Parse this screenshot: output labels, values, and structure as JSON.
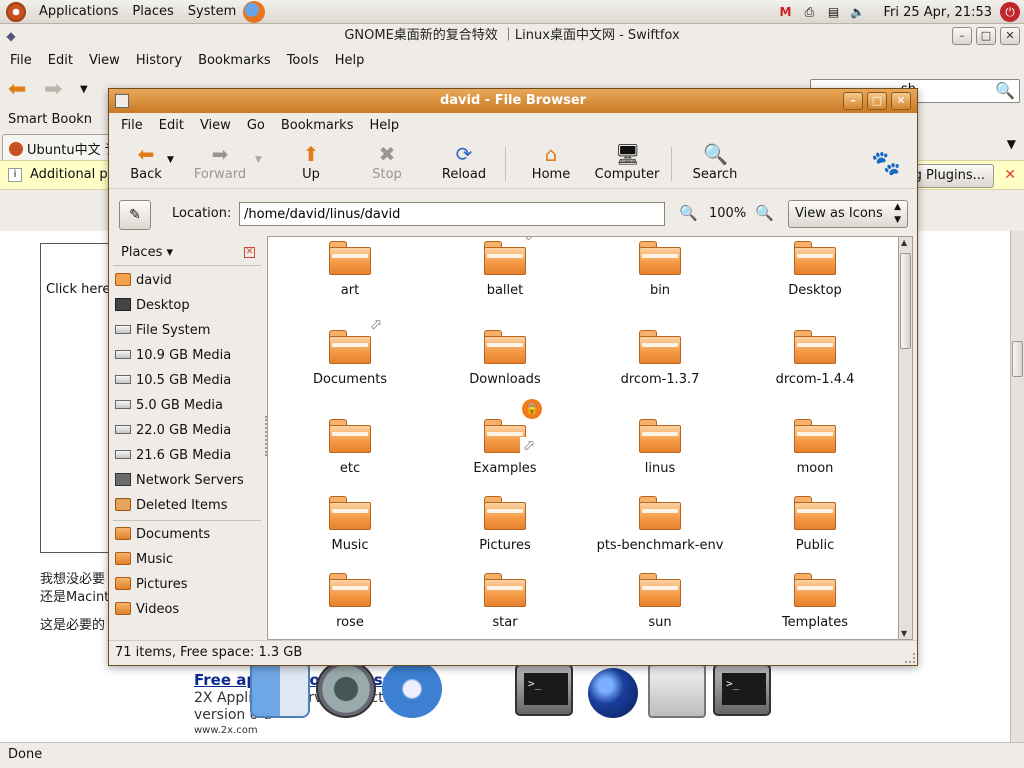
{
  "panel": {
    "menus": [
      "Applications",
      "Places",
      "System"
    ],
    "clock": "Fri 25 Apr, 21:53",
    "tray_icons": [
      "mail-icon",
      "printer-icon",
      "network-icon",
      "volume-icon"
    ]
  },
  "firefox": {
    "title": "GNOME桌面新的复合特效 ｜Linux桌面中文网 - Swiftfox",
    "menus": [
      "File",
      "Edit",
      "View",
      "History",
      "Bookmarks",
      "Tools",
      "Help"
    ],
    "search_text": "sh",
    "bookmarks_label": "Smart Bookn",
    "tab_label": "Ubuntu中文 讠",
    "notification": "Additional pl",
    "plugins_button": "g Plugins...",
    "status": "Done",
    "page": {
      "click_here": "Click here",
      "line1": "我想没必要",
      "line2": "还是Macinto",
      "line3": "这是必要的",
      "ad_title": "Free application access",
      "ad_line1": "2X Applicatio Serve      e 5      ection",
      "ad_line2": "version o         d",
      "ad_url": "www.2x.com"
    }
  },
  "file_browser": {
    "title": "david - File Browser",
    "menus": [
      "File",
      "Edit",
      "View",
      "Go",
      "Bookmarks",
      "Help"
    ],
    "toolbar": {
      "back": "Back",
      "forward": "Forward",
      "up": "Up",
      "stop": "Stop",
      "reload": "Reload",
      "home": "Home",
      "computer": "Computer",
      "search": "Search"
    },
    "location_label": "Location:",
    "location_value": "/home/david/linus/david",
    "zoom": "100%",
    "view_mode": "View as Icons",
    "places_label": "Places",
    "sidebar": [
      {
        "label": "david",
        "icon": "home-folder-icon"
      },
      {
        "label": "Desktop",
        "icon": "desktop-icon"
      },
      {
        "label": "File System",
        "icon": "drive-icon"
      },
      {
        "label": "10.9 GB Media",
        "icon": "drive-icon"
      },
      {
        "label": "10.5 GB Media",
        "icon": "drive-icon"
      },
      {
        "label": "5.0 GB Media",
        "icon": "drive-icon"
      },
      {
        "label": "22.0 GB Media",
        "icon": "drive-icon"
      },
      {
        "label": "21.6 GB Media",
        "icon": "drive-icon"
      },
      {
        "label": "Network Servers",
        "icon": "network-icon"
      },
      {
        "label": "Deleted Items",
        "icon": "trash-icon"
      }
    ],
    "bookmarks": [
      {
        "label": "Documents",
        "icon": "folder-icon"
      },
      {
        "label": "Music",
        "icon": "folder-icon"
      },
      {
        "label": "Pictures",
        "icon": "folder-icon"
      },
      {
        "label": "Videos",
        "icon": "folder-icon"
      }
    ],
    "folders": [
      {
        "label": "art",
        "emblem": ""
      },
      {
        "label": "ballet",
        "emblem": "link"
      },
      {
        "label": "bin",
        "emblem": ""
      },
      {
        "label": "Desktop",
        "emblem": ""
      },
      {
        "label": "Documents",
        "emblem": "link"
      },
      {
        "label": "Downloads",
        "emblem": ""
      },
      {
        "label": "drcom-1.3.7",
        "emblem": ""
      },
      {
        "label": "drcom-1.4.4",
        "emblem": ""
      },
      {
        "label": "etc",
        "emblem": ""
      },
      {
        "label": "Examples",
        "emblem": "lock-link"
      },
      {
        "label": "linus",
        "emblem": ""
      },
      {
        "label": "moon",
        "emblem": ""
      },
      {
        "label": "Music",
        "emblem": ""
      },
      {
        "label": "Pictures",
        "emblem": ""
      },
      {
        "label": "pts-benchmark-env",
        "emblem": ""
      },
      {
        "label": "Public",
        "emblem": ""
      },
      {
        "label": "rose",
        "emblem": ""
      },
      {
        "label": "star",
        "emblem": ""
      },
      {
        "label": "sun",
        "emblem": ""
      },
      {
        "label": "Templates",
        "emblem": ""
      }
    ],
    "status": "71 items, Free space: 1.3 GB"
  },
  "colors": {
    "titlebar_active": "#d48a32",
    "folder_orange": "#f59b48",
    "panel_bg": "#e8e4de"
  }
}
